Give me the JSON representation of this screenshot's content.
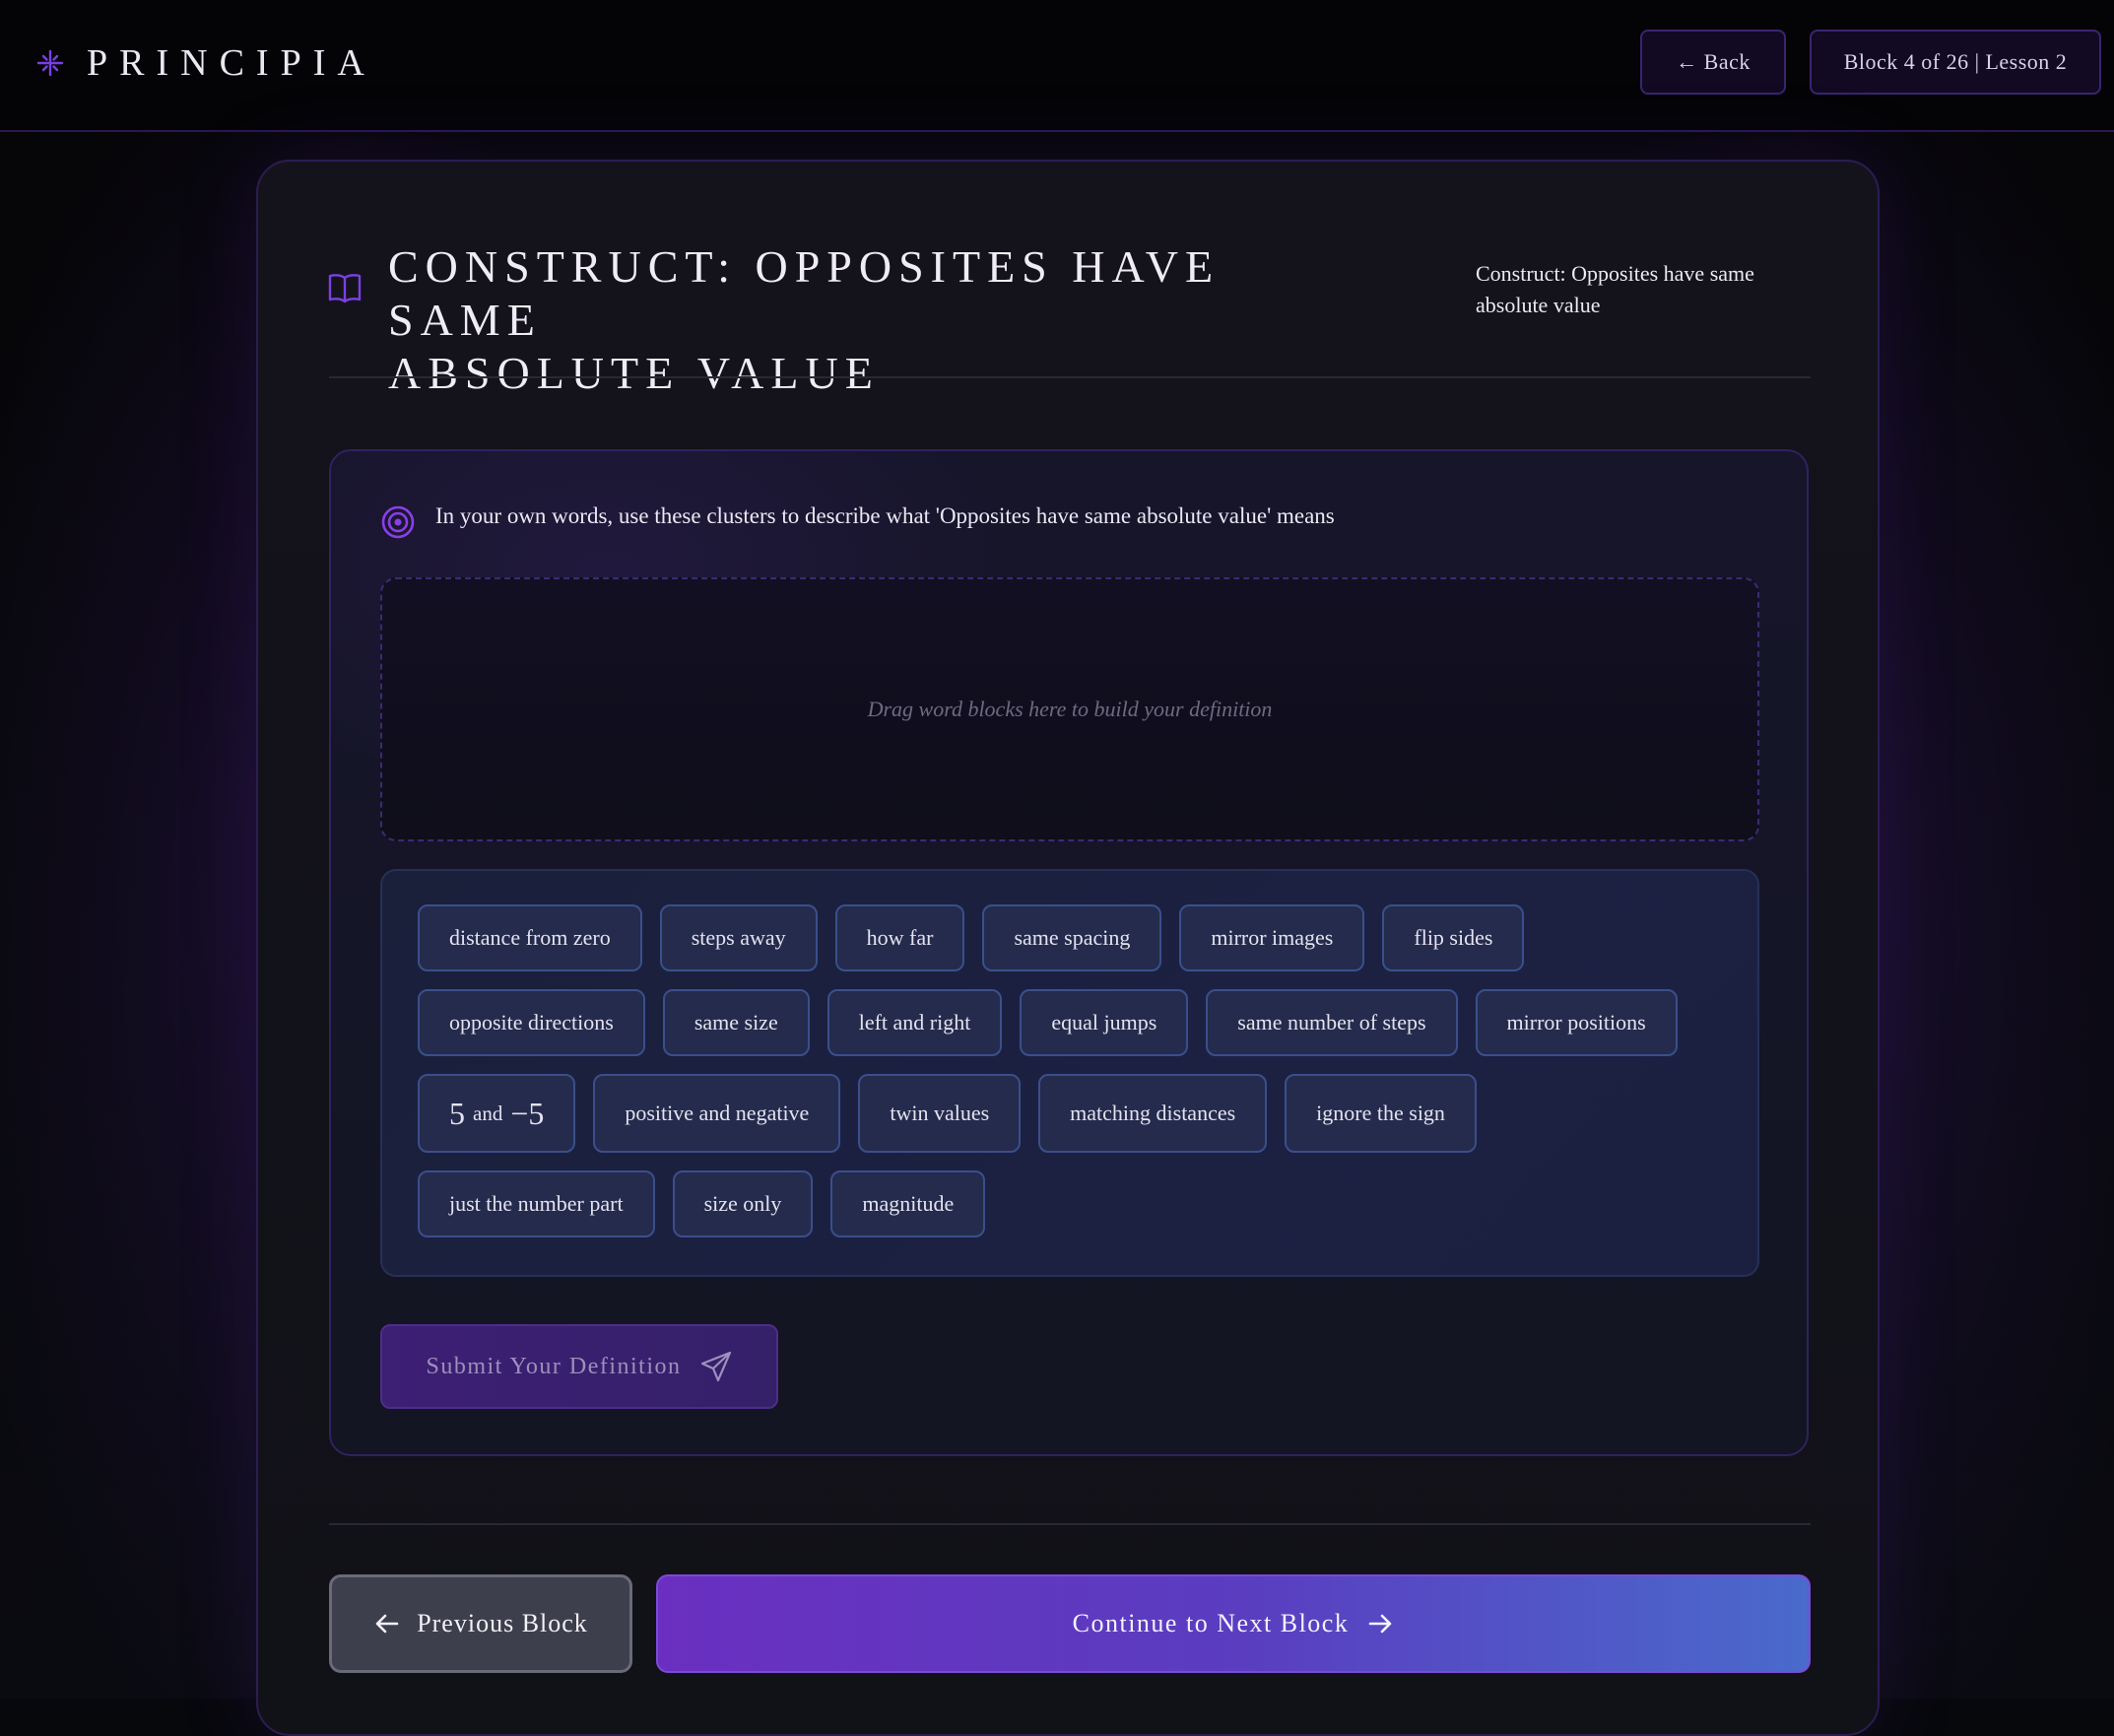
{
  "header": {
    "logo_text": "PRINCIPIA",
    "back_label": "← Back",
    "progress_label": "Block 4 of 26 | Lesson 2"
  },
  "block": {
    "title_line1": "CONSTRUCT: OPPOSITES HAVE SAME",
    "title_line2": "ABSOLUTE VALUE",
    "subtitle": "Construct: Opposites have same absolute value",
    "prompt": "In your own words, use these clusters to describe what 'Opposites have same absolute value' means",
    "dropzone_hint": "Drag word blocks here to build your definition",
    "submit_label": "Submit Your Definition"
  },
  "word_bank": {
    "row1": [
      "distance from zero",
      "steps away",
      "how far",
      "same spacing",
      "mirror images",
      "flip sides"
    ],
    "row2": [
      "opposite directions",
      "same size",
      "left and right",
      "equal jumps",
      "same number of steps",
      "mirror positions"
    ],
    "math_chip": {
      "a": "5",
      "and": "and",
      "b": "−5"
    },
    "row3": [
      "positive and negative",
      "twin values",
      "matching distances",
      "ignore the sign"
    ],
    "row4": [
      "just the number part",
      "size only",
      "magnitude"
    ]
  },
  "nav": {
    "prev_label": "Previous Block",
    "next_label": "Continue to Next Block"
  },
  "colors": {
    "accent": "#7b3fe4",
    "chip_bg": "#242b4c",
    "next_gradient_start": "#6a2fc0",
    "next_gradient_end": "#4a6acc"
  },
  "icons": [
    "sparkle-logo-icon",
    "book-icon",
    "target-icon",
    "send-icon",
    "arrow-left-icon",
    "arrow-right-icon"
  ]
}
